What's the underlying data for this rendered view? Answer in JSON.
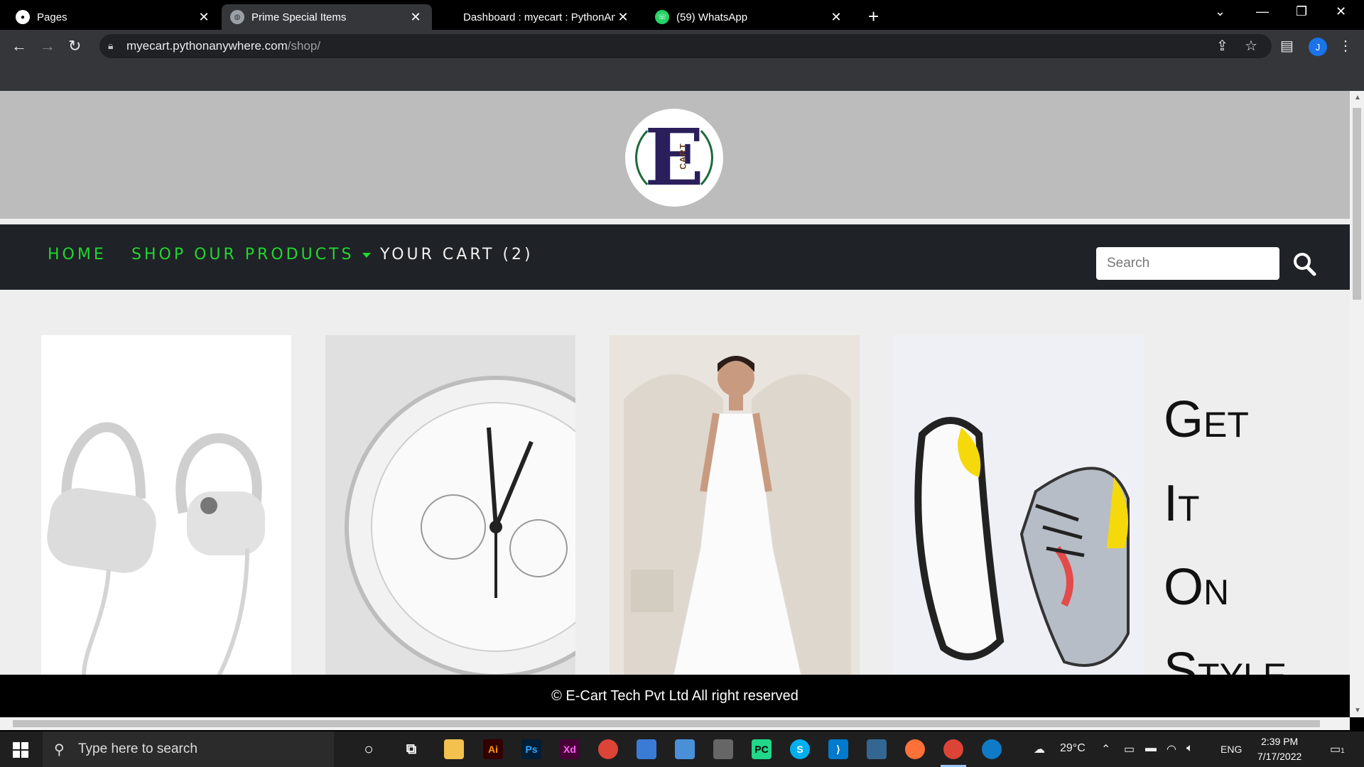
{
  "browser": {
    "tabs": [
      {
        "title": "Pages",
        "favicon": "github-icon"
      },
      {
        "title": "Prime Special Items",
        "favicon": "globe-icon"
      },
      {
        "title": "Dashboard : myecart : PythonAnywhere",
        "favicon": "pythonanywhere-icon"
      },
      {
        "title": "(59) WhatsApp",
        "favicon": "whatsapp-icon"
      }
    ],
    "url_host": "myecart.pythonanywhere.com",
    "url_path": "/shop/",
    "profile_initial": "J"
  },
  "site": {
    "logo_letter": "E",
    "logo_sub": "CART",
    "nav": {
      "home": "HOME",
      "shop": "SHOP OUR PRODUCTS",
      "cart": "YOUR CART (2)"
    },
    "search_placeholder": "Search",
    "promo_lines": [
      "Get",
      "It",
      "On",
      "Style"
    ],
    "product_images": [
      "earphones-image",
      "watch-image",
      "dress-image",
      "sneakers-image"
    ],
    "footer": "© E-Cart Tech Pvt Ltd All right reserved",
    "colors": {
      "nav_green": "#22d632",
      "nav_bg": "#1f2226",
      "header_bg": "#bcbcbc"
    }
  },
  "taskbar": {
    "search_placeholder": "Type here to search",
    "weather": "29°C",
    "language": "ENG",
    "time": "2:39 PM",
    "date": "7/17/2022",
    "notification_count": "1"
  }
}
